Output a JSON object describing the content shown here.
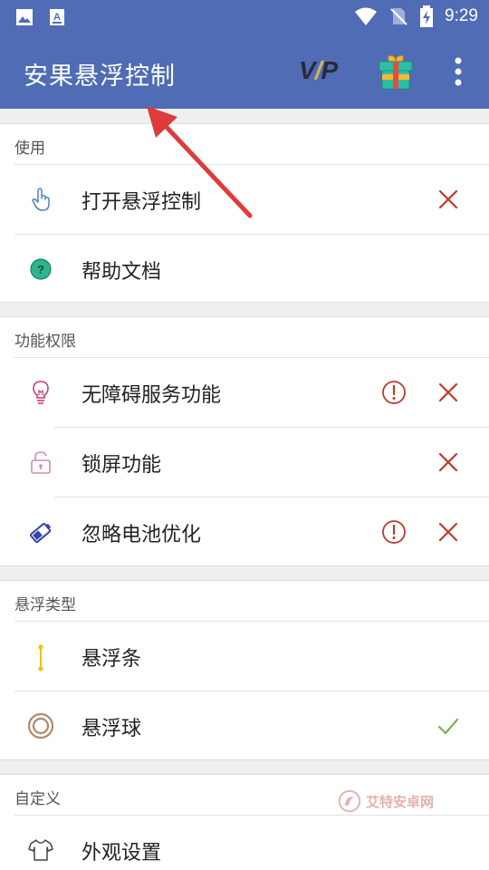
{
  "statusbar": {
    "time": "9:29"
  },
  "appbar": {
    "title": "安果悬浮控制",
    "vip_left": "V",
    "vip_bar": "/",
    "vip_right": "P"
  },
  "sections": {
    "usage": {
      "title": "使用",
      "items": [
        {
          "label": "打开悬浮控制",
          "status": "not-enabled"
        },
        {
          "label": "帮助文档"
        }
      ]
    },
    "permissions": {
      "title": "功能权限",
      "items": [
        {
          "label": "无障碍服务功能",
          "status": "not-enabled"
        },
        {
          "label": "锁屏功能",
          "status": "not-enabled"
        },
        {
          "label": "忽略电池优化",
          "status": "not-enabled"
        }
      ]
    },
    "float_type": {
      "title": "悬浮类型",
      "items": [
        {
          "label": "悬浮条"
        },
        {
          "label": "悬浮球",
          "status": "selected"
        }
      ]
    },
    "custom": {
      "title": "自定义",
      "items": [
        {
          "label": "外观设置"
        }
      ]
    }
  },
  "watermark": {
    "text": "艾特安卓网"
  },
  "colors": {
    "appbar": "#4f6cb5",
    "error": "#c0392b",
    "check": "#7cb342"
  }
}
